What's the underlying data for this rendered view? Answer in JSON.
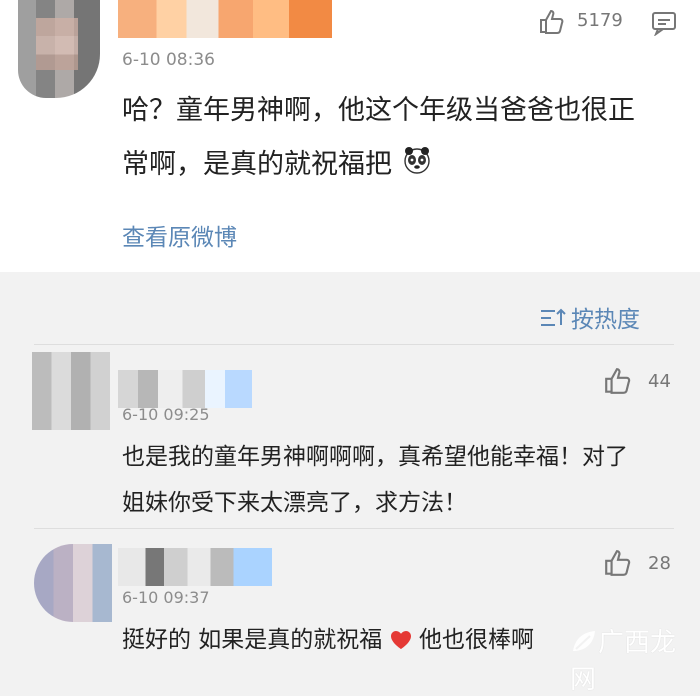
{
  "main_comment": {
    "timestamp": "6-10 08:36",
    "likes": "5179",
    "content_line1": "哈？童年男神啊，他这个年级当爸爸也很正",
    "content_line2": "常啊，是真的就祝福把",
    "view_original": "查看原微博"
  },
  "replies_section": {
    "sort_label": "按热度",
    "items": [
      {
        "timestamp": "6-10 09:25",
        "likes": "44",
        "content_line1": "也是我的童年男神啊啊啊，真希望他能幸福！对了",
        "content_line2": "姐妹你受下来太漂亮了，求方法！"
      },
      {
        "timestamp": "6-10 09:37",
        "likes": "28",
        "content_before_heart": "挺好的 如果是真的就祝福",
        "content_after_heart": " 他也很棒啊"
      }
    ]
  },
  "watermark": {
    "text": "广西龙网"
  },
  "colors": {
    "link_blue": "#5b87b6",
    "gray_text": "#8c8c8c",
    "heart_red": "#e53935"
  },
  "icons": {
    "like": "thumb-up-icon",
    "comment": "comment-icon",
    "emoji": "panda-emoji-icon",
    "heart": "heart-icon",
    "sort": "sort-icon",
    "watermark": "leaf-logo-icon"
  }
}
